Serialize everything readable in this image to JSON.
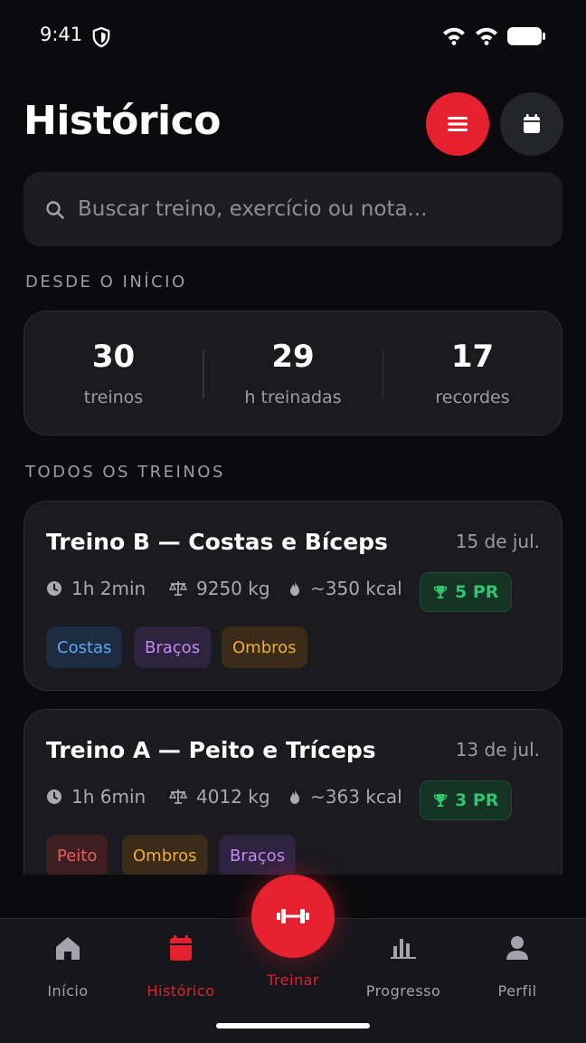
{
  "status_bar": {
    "time": "9:41"
  },
  "header": {
    "title": "Histórico"
  },
  "search": {
    "placeholder": "Buscar treino, exercício ou nota..."
  },
  "summary": {
    "section_label": "DESDE O INÍCIO",
    "stats": [
      {
        "value": "30",
        "label": "treinos"
      },
      {
        "value": "29",
        "label": "h treinadas"
      },
      {
        "value": "17",
        "label": "recordes"
      }
    ]
  },
  "workouts": {
    "section_label": "TODOS OS TREINOS",
    "items": [
      {
        "title": "Treino B — Costas e Bíceps",
        "date": "15 de jul.",
        "duration": "1h 2min",
        "volume": "9250 kg",
        "calories": "~350 kcal",
        "pr": "5 PR",
        "tags": [
          {
            "label": "Costas",
            "color": "blue"
          },
          {
            "label": "Braços",
            "color": "purple"
          },
          {
            "label": "Ombros",
            "color": "orange"
          }
        ]
      },
      {
        "title": "Treino A — Peito e Tríceps",
        "date": "13 de jul.",
        "duration": "1h 6min",
        "volume": "4012 kg",
        "calories": "~363 kcal",
        "pr": "3 PR",
        "tags": [
          {
            "label": "Peito",
            "color": "red"
          },
          {
            "label": "Ombros",
            "color": "orange"
          },
          {
            "label": "Braços",
            "color": "purple"
          }
        ]
      }
    ]
  },
  "bottom_nav": {
    "items": [
      {
        "label": "Início",
        "icon": "home-icon"
      },
      {
        "label": "Histórico",
        "icon": "calendar-icon",
        "active": true
      },
      {
        "label": "Treinar",
        "icon": "dumbbell-icon"
      },
      {
        "label": "Progresso",
        "icon": "bar-chart-icon"
      },
      {
        "label": "Perfil",
        "icon": "user-icon"
      }
    ]
  },
  "colors": {
    "accent": "#e5202f",
    "background": "#0b0b0d",
    "card": "#1a1a1f",
    "pr_green": "#2fc56f"
  }
}
